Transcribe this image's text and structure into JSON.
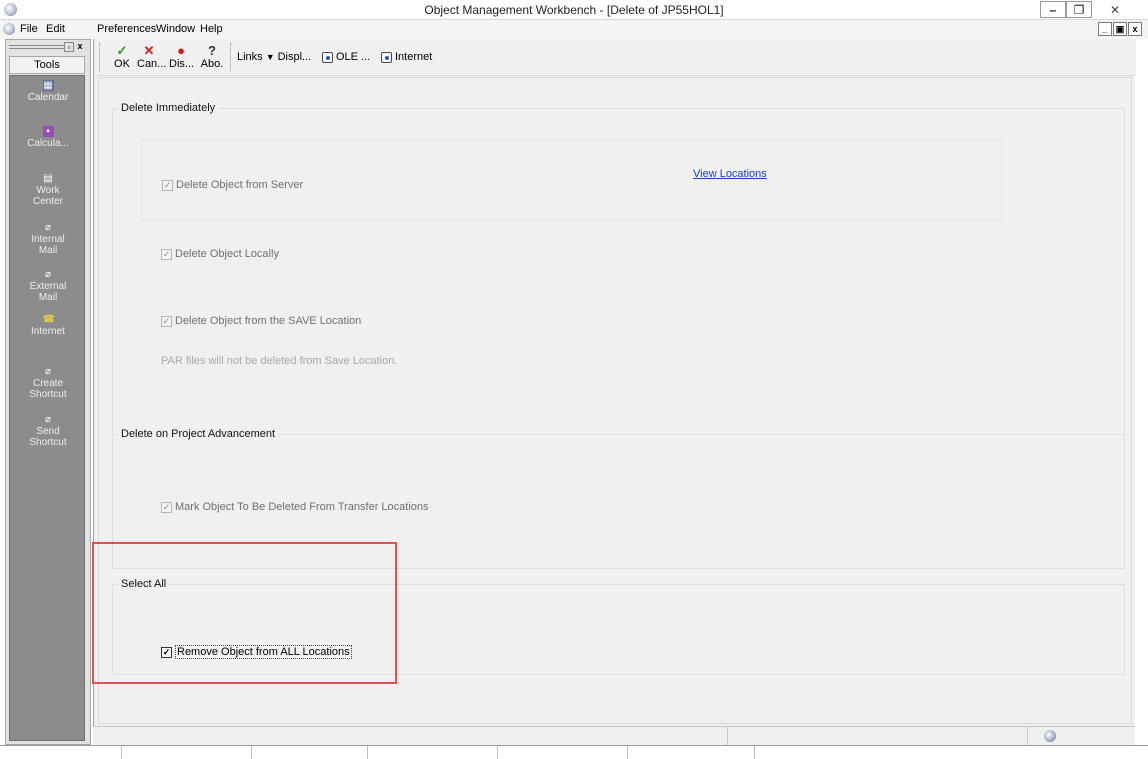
{
  "window": {
    "title": "Object Management Workbench - [Delete of JP55HOL1]",
    "min_glyph": "–",
    "max_glyph": "❐",
    "close_glyph": "✕"
  },
  "menu": {
    "file": "File",
    "edit": "Edit",
    "preferences": "Preferences",
    "window": "Window",
    "help": "Help",
    "mdi_min": "_",
    "mdi_restore": "▣",
    "mdi_close": "x"
  },
  "left_panel": {
    "pin_glyph": "▫",
    "close_glyph": "x",
    "tools_label": "Tools",
    "items": [
      {
        "label1": "Calendar",
        "label2": "",
        "icon": "calendar-icon"
      },
      {
        "label1": "Calcula...",
        "label2": "",
        "icon": "calculator-icon"
      },
      {
        "label1": "Work",
        "label2": "Center",
        "icon": "work-center-icon"
      },
      {
        "label1": "Internal",
        "label2": "Mail",
        "icon": "internal-mail-icon"
      },
      {
        "label1": "External",
        "label2": "Mail",
        "icon": "external-mail-icon"
      },
      {
        "label1": "Internet",
        "label2": "",
        "icon": "internet-icon"
      },
      {
        "label1": "Create",
        "label2": "Shortcut",
        "icon": "create-shortcut-icon"
      },
      {
        "label1": "Send",
        "label2": "Shortcut",
        "icon": "send-shortcut-icon"
      }
    ]
  },
  "toolbar": {
    "ok": "OK",
    "cancel": "Can...",
    "display": "Dis...",
    "about": "Abo.",
    "links": "Links",
    "links_arrow": "▼",
    "displ": "Displ...",
    "ole": "OLE ...",
    "internet": "Internet"
  },
  "form": {
    "delete_immediately": {
      "title": "Delete Immediately",
      "from_server": {
        "label": "Delete Object from Server",
        "checked": true
      },
      "view_locations": "View Locations",
      "locally": {
        "label": "Delete Object Locally",
        "checked": true
      },
      "save_location": {
        "label": "Delete Object from the SAVE Location",
        "checked": true
      },
      "par_note": "PAR files will not be deleted from Save Location."
    },
    "project_advancement": {
      "title": "Delete on Project Advancement",
      "transfer": {
        "label": "Mark Object To Be Deleted From Transfer Locations",
        "checked": true
      }
    },
    "select_all": {
      "title": "Select All",
      "remove_all": {
        "label": "Remove Object from ALL Locations",
        "checked": true
      }
    },
    "check_glyph": "✓"
  },
  "colors": {
    "highlight_border": "#e05050",
    "link": "#1a3ec8",
    "tools_panel": "#8c8c8c"
  }
}
